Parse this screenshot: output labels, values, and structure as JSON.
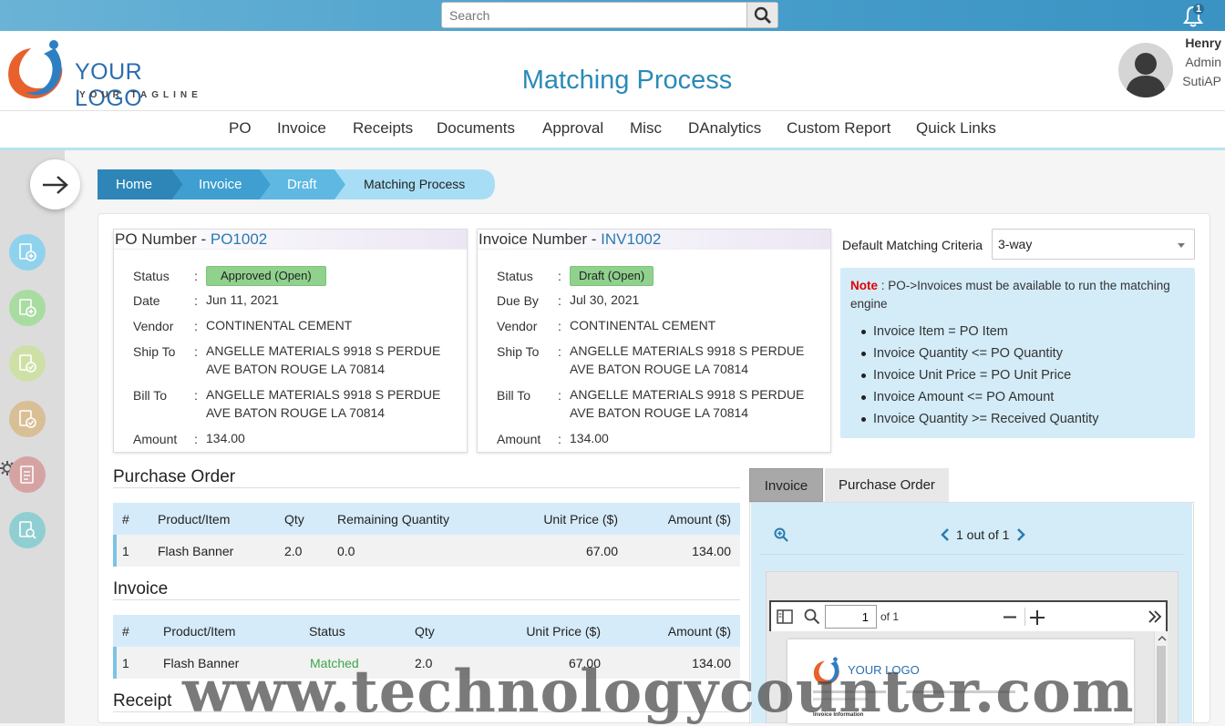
{
  "topbar": {
    "search_placeholder": "Search",
    "notification_count": "1"
  },
  "logo": {
    "text": "YOUR LOGO",
    "tagline": "YOUR TAGLINE"
  },
  "page_title": "Matching Process",
  "user": {
    "name": "Henry",
    "role": "Admin",
    "app": "SutiAP"
  },
  "nav": [
    "PO",
    "Invoice",
    "Receipts",
    "Documents",
    "Approval",
    "Misc",
    "DAnalytics",
    "Custom Report",
    "Quick Links"
  ],
  "breadcrumb": [
    "Home",
    "Invoice",
    "Draft",
    "Matching Process"
  ],
  "po_card": {
    "label": "PO Number - ",
    "number": "PO1002",
    "status": "Approved   (Open)",
    "date": "Jun 11, 2021",
    "vendor": "CONTINENTAL CEMENT",
    "ship_to_1": "ANGELLE MATERIALS 9918 S PERDUE",
    "ship_to_2": "AVE BATON ROUGE LA 70814",
    "bill_to_1": "ANGELLE MATERIALS 9918 S PERDUE",
    "bill_to_2": "AVE BATON ROUGE LA 70814",
    "amount": "134.00",
    "labels": {
      "status": "Status",
      "date": "Date",
      "vendor": "Vendor",
      "ship_to": "Ship To",
      "bill_to": "Bill To",
      "amount": "Amount"
    }
  },
  "inv_card": {
    "label": "Invoice Number - ",
    "number": "INV1002",
    "status": "Draft (Open)",
    "due_by": "Jul 30, 2021",
    "vendor": "CONTINENTAL CEMENT",
    "ship_to_1": "ANGELLE MATERIALS 9918 S PERDUE",
    "ship_to_2": "AVE BATON ROUGE LA 70814",
    "bill_to_1": "ANGELLE MATERIALS 9918 S PERDUE",
    "bill_to_2": "AVE BATON ROUGE LA 70814",
    "amount": "134.00",
    "labels": {
      "status": "Status",
      "due_by": "Due By",
      "vendor": "Vendor",
      "ship_to": "Ship To",
      "bill_to": "Bill To",
      "amount": "Amount"
    }
  },
  "criteria": {
    "label": "Default Matching Criteria",
    "value": "3-way"
  },
  "note": {
    "label": "Note",
    "text": " : PO->Invoices must be available to run the matching engine",
    "rules": [
      "Invoice Item = PO Item",
      "Invoice Quantity <= PO Quantity",
      "Invoice Unit Price = PO Unit Price",
      "Invoice Amount <= PO Amount",
      "Invoice Quantity >= Received Quantity"
    ]
  },
  "purchase_order": {
    "title": "Purchase Order",
    "headers": [
      "#",
      "Product/Item",
      "Qty",
      "Remaining Quantity",
      "Unit Price ($)",
      "Amount ($)"
    ],
    "rows": [
      [
        "1",
        "Flash Banner",
        "2.0",
        "0.0",
        "67.00",
        "134.00"
      ]
    ]
  },
  "invoice": {
    "title": "Invoice",
    "headers": [
      "#",
      "Product/Item",
      "Status",
      "Qty",
      "Unit Price ($)",
      "Amount ($)"
    ],
    "rows": [
      [
        "1",
        "Flash Banner",
        "Matched",
        "2.0",
        "67.00",
        "134.00"
      ]
    ]
  },
  "receipt": {
    "title": "Receipt"
  },
  "doc_tabs": [
    "Invoice",
    "Purchase Order"
  ],
  "viewer": {
    "pager": "1 out of 1",
    "page_input": "1",
    "page_of": "of 1"
  },
  "pdf_preview": {
    "logo_text": "YOUR LOGO",
    "line1": "Invoice Information"
  },
  "watermark": "www.technologycounter.com",
  "colors": {
    "accent": "#2a8ab8",
    "approved_pill": "#8fd18d",
    "matched_text": "#3aa84a",
    "note_bg": "#d3ecf8",
    "breadcrumb_dark": "#2e86b8",
    "breadcrumb_light": "#a8def5"
  }
}
